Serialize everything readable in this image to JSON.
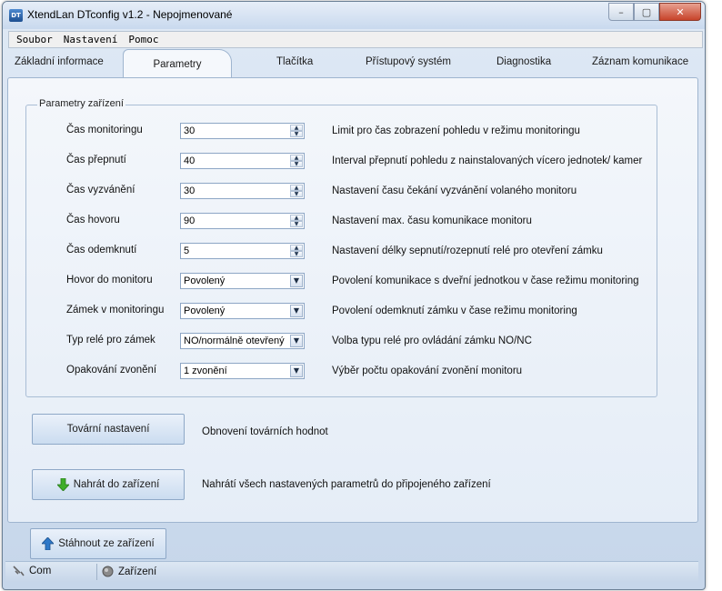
{
  "window": {
    "title": "XtendLan DTconfig v1.2 - Nepojmenované",
    "icon_text": "DT",
    "controls": {
      "minimize": "–",
      "maximize": "▢",
      "close": "✕"
    }
  },
  "menu": [
    "Soubor",
    "Nastavení",
    "Pomoc"
  ],
  "tabs": {
    "t0": "Základní informace",
    "t1": "Parametry",
    "t2": "Tlačítka",
    "t3": "Přístupový systém",
    "t4": "Diagnostika",
    "t5": "Záznam komunikace",
    "active": "Parametry"
  },
  "group": {
    "title": "Parametry zařízení",
    "rows": [
      {
        "label": "Čas monitoringu",
        "value": "30",
        "control": "spin",
        "desc": "Limit pro čas zobrazení pohledu v režimu monitoringu"
      },
      {
        "label": "Čas přepnutí",
        "value": "40",
        "control": "spin",
        "desc": "Interval přepnutí pohledu z nainstalovaných vícero jednotek/ kamer"
      },
      {
        "label": "Čas vyzvánění",
        "value": "30",
        "control": "spin",
        "desc": "Nastavení času čekání vyzvánění volaného monitoru"
      },
      {
        "label": "Čas hovoru",
        "value": "90",
        "control": "spin",
        "desc": "Nastavení max. času komunikace monitoru"
      },
      {
        "label": "Čas odemknutí",
        "value": "5",
        "control": "spin",
        "desc": "Nastavení délky sepnutí/rozepnutí relé pro otevření zámku"
      },
      {
        "label": "Hovor do monitoru",
        "value": "Povolený",
        "control": "select",
        "desc": "Povolení komunikace s dveřní jednotkou v čase režimu monitoring"
      },
      {
        "label": "Zámek v monitoringu",
        "value": "Povolený",
        "control": "select",
        "desc": "Povolení odemknutí zámku v čase režimu monitoring"
      },
      {
        "label": "Typ relé pro zámek",
        "value": "NO/normálně otevřený",
        "control": "select",
        "desc": "Volba typu relé pro ovládání zámku NO/NC"
      },
      {
        "label": "Opakování zvonění",
        "value": "1 zvonění",
        "control": "select",
        "desc": "Výběr počtu opakování zvonění monitoru"
      }
    ]
  },
  "buttons": {
    "factory": {
      "label": "Tovární nastavení",
      "desc": "Obnovení továrních hodnot"
    },
    "upload": {
      "label": "Nahrát do zařízení",
      "desc": "Nahrátí všech nastavených parametrů do připojeného zařízení",
      "icon": "arrow-down-icon"
    },
    "download": {
      "label": "Stáhnout ze zařízení",
      "icon": "arrow-up-icon"
    }
  },
  "status": {
    "com": "Com",
    "device": "Zařízení"
  },
  "colors": {
    "accent": "#3a8e2a",
    "upload_icon": "#3fae2a",
    "download_icon": "#2e78c8"
  }
}
